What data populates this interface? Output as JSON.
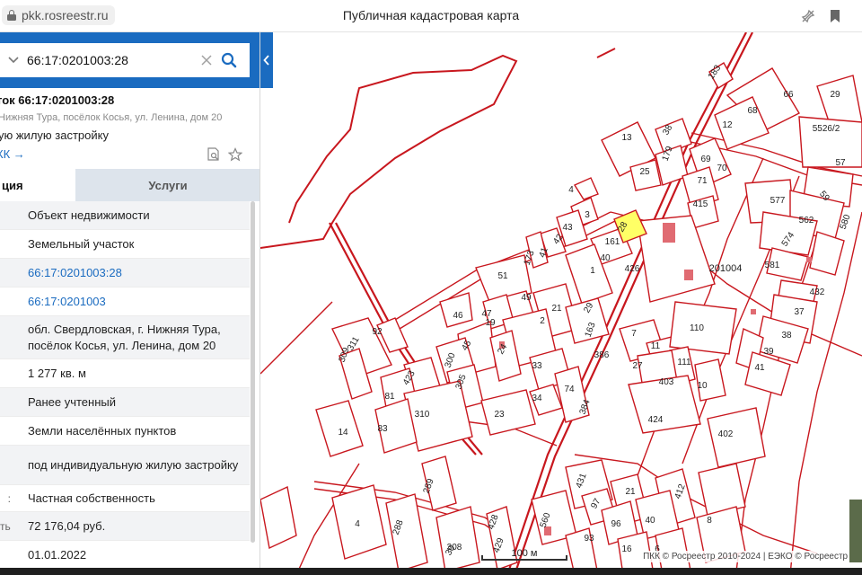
{
  "browser": {
    "url": "pkk.rosreestr.ru",
    "page_title": "Публичная кадастровая карта"
  },
  "search": {
    "value": "66:17:0201003:28"
  },
  "object": {
    "title": "ток 66:17:0201003:28",
    "address_short": "Нижняя Тура, посёлок Косья, ул. Ленина, дом 20",
    "use_short": "ую жилую застройку",
    "link": "КК →"
  },
  "tabs": {
    "active": "ция",
    "services": "Услуги"
  },
  "rows": [
    {
      "label": "",
      "value": "Объект недвижимости",
      "link": false
    },
    {
      "label": "",
      "value": "Земельный участок",
      "link": false
    },
    {
      "label": "",
      "value": "66:17:0201003:28",
      "link": true
    },
    {
      "label": "",
      "value": "66:17:0201003",
      "link": true
    },
    {
      "label": "",
      "value": "обл. Свердловская, г. Нижняя Тура, посёлок Косья, ул. Ленина, дом 20",
      "link": false
    },
    {
      "label": "",
      "value": "1 277 кв. м",
      "link": false
    },
    {
      "label": "",
      "value": "Ранее учтенный",
      "link": false
    },
    {
      "label": "",
      "value": "Земли населённых пунктов",
      "link": false
    },
    {
      "label": "",
      "value": "под индивидуальную жилую застройку",
      "link": false
    },
    {
      "label": ":",
      "value": "Частная собственность",
      "link": false
    },
    {
      "label": "ть:",
      "value": "72 176,04 руб.",
      "link": false
    },
    {
      "label": "",
      "value": "01.01.2022",
      "link": false
    }
  ],
  "map": {
    "scale_label": "100 м",
    "block_label": "201004",
    "copyright": "ПКК © Росреестр 2010-2024 | ЕЭКО © Росреестр 20",
    "plot_labels": [
      "183",
      "66",
      "29",
      "68",
      "12",
      "5526/2",
      "13",
      "38",
      "179",
      "69",
      "70",
      "57",
      "25",
      "71",
      "4",
      "415",
      "577",
      "59",
      "3",
      "43",
      "28",
      "562",
      "580",
      "42",
      "161",
      "574",
      "41",
      "173",
      "40",
      "426",
      "581",
      "51",
      "1",
      "49",
      "21",
      "29",
      "432",
      "46",
      "47",
      "2",
      "163",
      "37",
      "19",
      "110",
      "45",
      "24",
      "7",
      "11",
      "38",
      "92",
      "311",
      "300",
      "386",
      "27",
      "111",
      "39",
      "309",
      "305",
      "33",
      "403",
      "10",
      "41",
      "423",
      "74",
      "81",
      "310",
      "384",
      "424",
      "23",
      "34",
      "83",
      "14",
      "402",
      "289",
      "431",
      "21",
      "412",
      "8",
      "4",
      "288",
      "30",
      "428",
      "560",
      "97",
      "96",
      "40",
      "429",
      "308",
      "93",
      "16",
      "6",
      "16"
    ],
    "colors": {
      "parcel": "#c8171e",
      "selected": "#ffff66",
      "building": "#e06b72"
    }
  }
}
